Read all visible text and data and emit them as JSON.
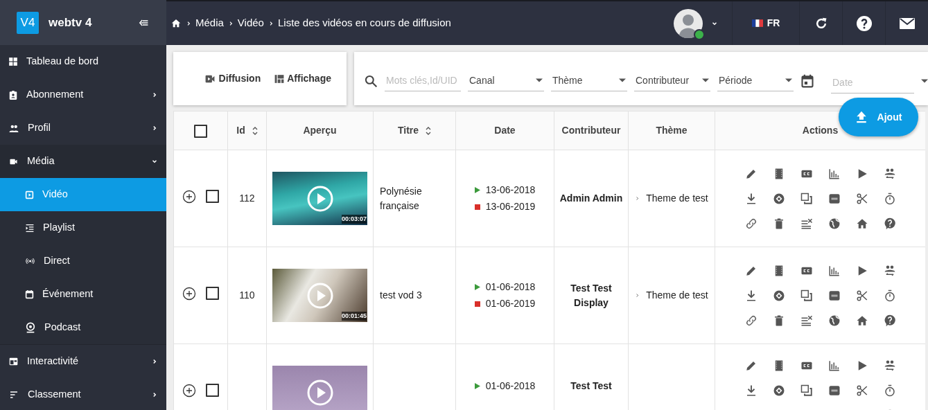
{
  "brand": {
    "logo": "V4",
    "name": "webtv 4"
  },
  "sidebar": {
    "items": [
      {
        "label": "Tableau de bord",
        "selected": false
      },
      {
        "label": "Abonnement",
        "selected": false,
        "expanded": false
      },
      {
        "label": "Profil",
        "selected": false,
        "expanded": false
      },
      {
        "label": "Média",
        "selected": false,
        "expanded": true,
        "children": [
          {
            "label": "Vidéo",
            "selected": true
          },
          {
            "label": "Playlist",
            "selected": false
          },
          {
            "label": "Direct",
            "selected": false
          },
          {
            "label": "Événement",
            "selected": false
          },
          {
            "label": "Podcast",
            "selected": false
          }
        ]
      },
      {
        "label": "Interactivité",
        "selected": false,
        "expanded": false
      },
      {
        "label": "Classement",
        "selected": false,
        "expanded": false
      }
    ]
  },
  "breadcrumb": [
    "Média",
    "Vidéo",
    "Liste des vidéos en cours de diffusion"
  ],
  "user": {
    "online": true
  },
  "language": "FR",
  "toolbar": {
    "buttons": [
      {
        "label": "Diffusion"
      },
      {
        "label": "Affichage"
      }
    ]
  },
  "filters": {
    "search": {
      "placeholder": "Mots clés,Id/UID"
    },
    "selects": [
      {
        "label": "Canal"
      },
      {
        "label": "Thème"
      },
      {
        "label": "Contributeur"
      },
      {
        "label": "Période"
      }
    ],
    "date": {
      "placeholder": "Date"
    }
  },
  "add_button": "Ajout",
  "table": {
    "select_all": {
      "checked": false
    },
    "columns": [
      {
        "label": "Id",
        "sortable": true
      },
      {
        "label": "Aperçu",
        "sortable": false
      },
      {
        "label": "Titre",
        "sortable": true
      },
      {
        "label": "Date",
        "sortable": false
      },
      {
        "label": "Contributeur",
        "sortable": false
      },
      {
        "label": "Thème",
        "sortable": false
      },
      {
        "label": "Actions",
        "sortable": false
      }
    ],
    "rows": [
      {
        "checked": false,
        "id": "112",
        "duration": "00:03:07",
        "title": "Polynésie française",
        "start": "13-06-2018",
        "end": "13-06-2019",
        "contributor": "Admin Admin",
        "theme": "Theme de test"
      },
      {
        "checked": false,
        "id": "110",
        "duration": "00:01:45",
        "title": "test vod 3",
        "start": "01-06-2018",
        "end": "01-06-2019",
        "contributor": "Test Test Display",
        "theme": "Theme de test"
      },
      {
        "checked": false,
        "start": "01-06-2018",
        "contributor": "Test Test"
      }
    ]
  }
}
